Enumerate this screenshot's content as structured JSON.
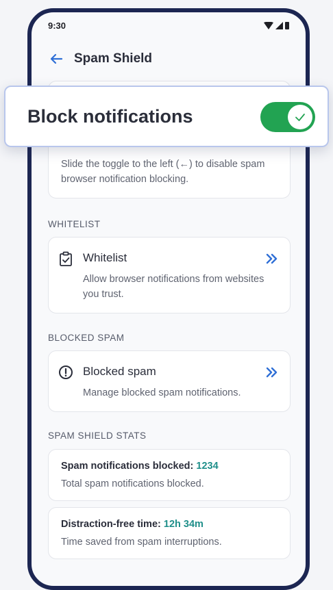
{
  "status_bar": {
    "time": "9:30"
  },
  "app_bar": {
    "title": "Spam Shield"
  },
  "block_notifications": {
    "label": "Block notifications",
    "enabled": true,
    "description": "Slide the toggle to the left (←) to disable spam browser notification blocking."
  },
  "whitelist_section": {
    "header": "WHITELIST",
    "title": "Whitelist",
    "description": "Allow browser notifications from websites you trust."
  },
  "blocked_section": {
    "header": "BLOCKED SPAM",
    "title": "Blocked spam",
    "description": "Manage blocked spam notifications."
  },
  "stats_section": {
    "header": "SPAM SHIELD STATS",
    "items": [
      {
        "label": "Spam notifications blocked:",
        "value": "1234",
        "description": "Total spam notifications blocked."
      },
      {
        "label": "Distraction-free time:",
        "value": "12h 34m",
        "description": "Time saved from spam interruptions."
      }
    ]
  },
  "colors": {
    "accent": "#2f6fd6",
    "toggle_on": "#22a352",
    "stat_value": "#1f8f8a",
    "frame": "#1c2652"
  },
  "icons": [
    "back-arrow-icon",
    "wifi-icon",
    "signal-icon",
    "battery-icon",
    "clipboard-check-icon",
    "alert-circle-icon",
    "double-chevron-right-icon",
    "check-icon"
  ]
}
